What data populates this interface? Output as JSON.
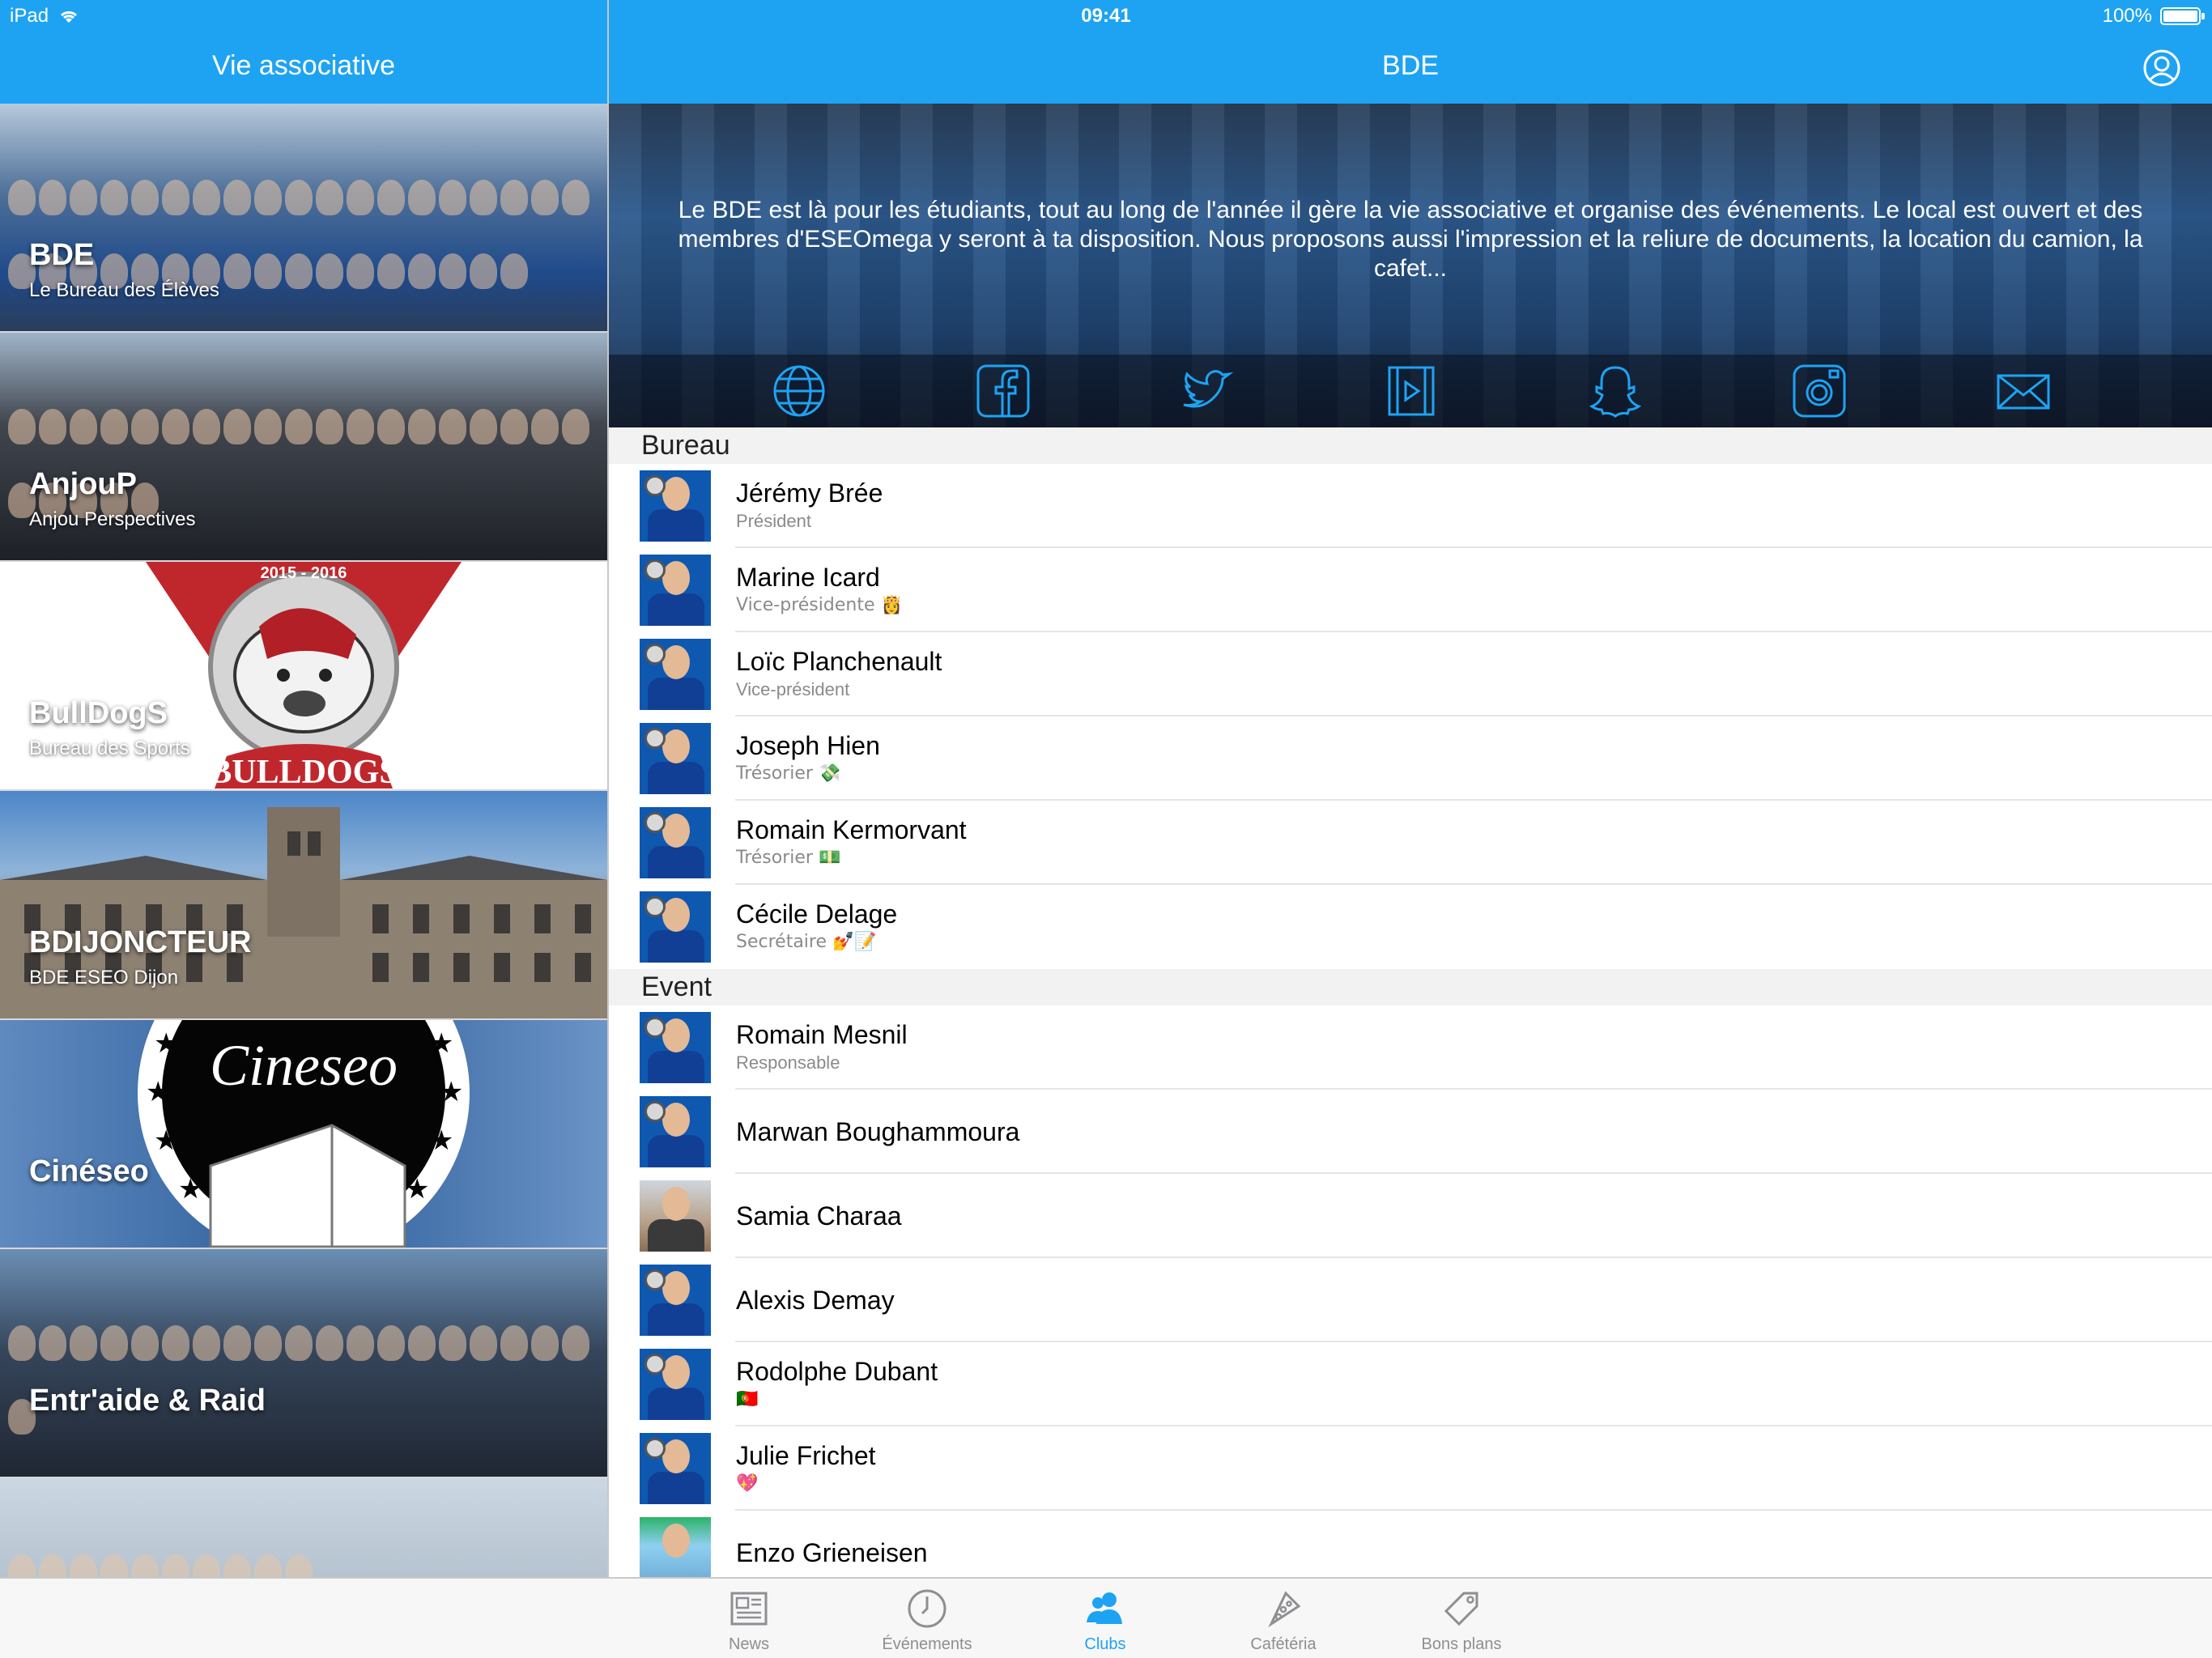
{
  "status_bar": {
    "device": "iPad",
    "time": "09:41",
    "battery": "100%",
    "battery_level": 1.0
  },
  "master": {
    "title": "Vie associative",
    "clubs": [
      {
        "name": "BDE",
        "subtitle": "Le Bureau des Élèves"
      },
      {
        "name": "AnjouP",
        "subtitle": "Anjou Perspectives"
      },
      {
        "name": "BullDogS",
        "subtitle": "Bureau des Sports",
        "logo_year": "2015 - 2016",
        "logo_text": "BULLDOGS"
      },
      {
        "name": "BDIJONCTEUR",
        "subtitle": "BDE ESEO Dijon"
      },
      {
        "name": "Cinéseo",
        "subtitle": "",
        "logo_text": "Cineseo"
      },
      {
        "name": "Entr'aide & Raid",
        "subtitle": ""
      },
      {
        "name": "",
        "subtitle": ""
      }
    ]
  },
  "detail": {
    "title": "BDE",
    "description": "Le BDE est là pour les étudiants, tout au long de l'année il gère la vie associative et organise des événements. Le local est ouvert et des membres d'ESEOmega y seront à ta disposition. Nous proposons aussi l'impression et la reliure de documents, la location du camion, la cafet...",
    "social_icons": [
      "web-icon",
      "facebook-icon",
      "twitter-icon",
      "video-icon",
      "snapchat-icon",
      "instagram-icon",
      "mail-icon"
    ],
    "sections": [
      {
        "title": "Bureau",
        "members": [
          {
            "name": "Jérémy Brée",
            "role": "Président"
          },
          {
            "name": "Marine Icard",
            "role": "Vice-présidente 👸"
          },
          {
            "name": "Loïc Planchenault",
            "role": "Vice-président"
          },
          {
            "name": "Joseph Hien",
            "role": "Trésorier 💸"
          },
          {
            "name": "Romain Kermorvant",
            "role": "Trésorier 💵"
          },
          {
            "name": "Cécile Delage",
            "role": "Secrétaire 💅📝"
          }
        ]
      },
      {
        "title": "Event",
        "members": [
          {
            "name": "Romain Mesnil",
            "role": "Responsable"
          },
          {
            "name": "Marwan Boughammoura",
            "role": ""
          },
          {
            "name": "Samia Charaa",
            "role": ""
          },
          {
            "name": "Alexis Demay",
            "role": ""
          },
          {
            "name": "Rodolphe Dubant",
            "role": "🇵🇹"
          },
          {
            "name": "Julie Frichet",
            "role": "💖"
          },
          {
            "name": "Enzo Grieneisen",
            "role": ""
          }
        ]
      }
    ]
  },
  "tabbar": {
    "tabs": [
      {
        "label": "News",
        "icon": "newspaper-icon"
      },
      {
        "label": "Événements",
        "icon": "clock-icon"
      },
      {
        "label": "Clubs",
        "icon": "people-icon",
        "active": true
      },
      {
        "label": "Cafétéria",
        "icon": "pizza-icon"
      },
      {
        "label": "Bons plans",
        "icon": "tag-icon"
      }
    ]
  },
  "colors": {
    "accent": "#1ea3f3",
    "tab_inactive": "#8e8e93",
    "section_bg": "#f2f2f2"
  }
}
